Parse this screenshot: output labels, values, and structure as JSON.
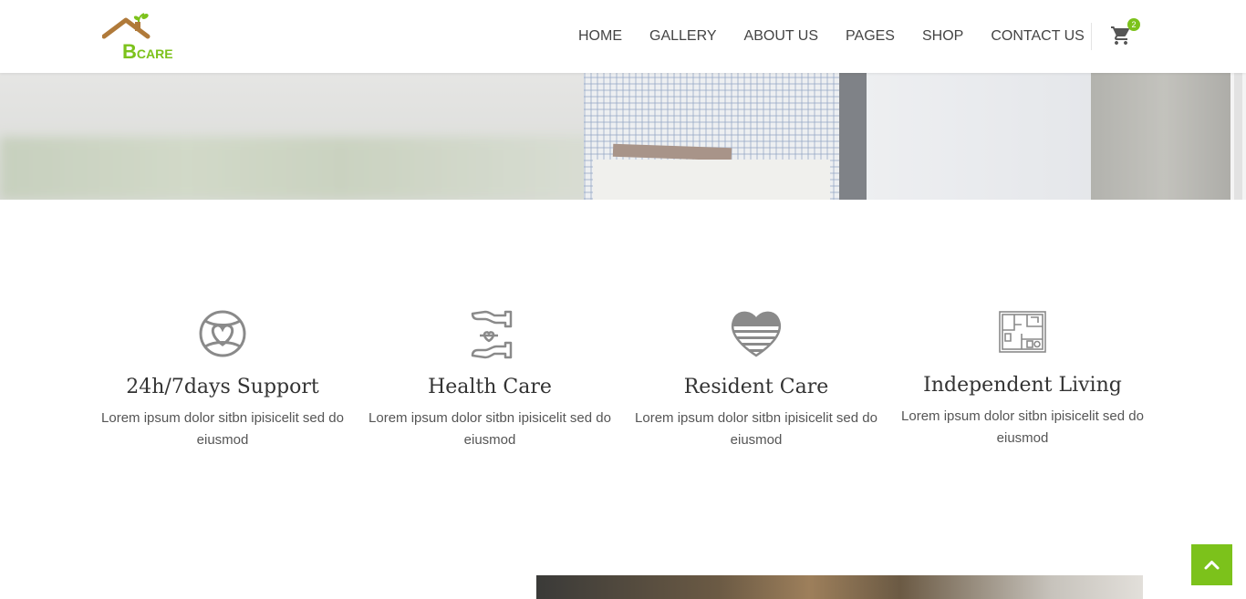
{
  "logo": {
    "letter": "B",
    "rest": "CARE"
  },
  "nav": {
    "items": [
      "HOME",
      "GALLERY",
      "ABOUT US",
      "PAGES",
      "SHOP",
      "CONTACT US"
    ],
    "cart_count": "2"
  },
  "features": [
    {
      "title": "24h/7days Support",
      "text": "Lorem ipsum dolor sitbn ipisicelit sed do eiusmod",
      "icon": "globe-heart-icon"
    },
    {
      "title": "Health Care",
      "text": "Lorem ipsum dolor sitbn ipisicelit sed do eiusmod",
      "icon": "hands-heart-icon"
    },
    {
      "title": "Resident Care",
      "text": "Lorem ipsum dolor sitbn ipisicelit sed do eiusmod",
      "icon": "striped-heart-icon"
    },
    {
      "title": "Independent Living",
      "text": "Lorem ipsum dolor sitbn ipisicelit sed do eiusmod",
      "icon": "floor-plan-icon"
    }
  ],
  "colors": {
    "accent": "#7cc21b",
    "logo_roof": "#b07a3a"
  }
}
